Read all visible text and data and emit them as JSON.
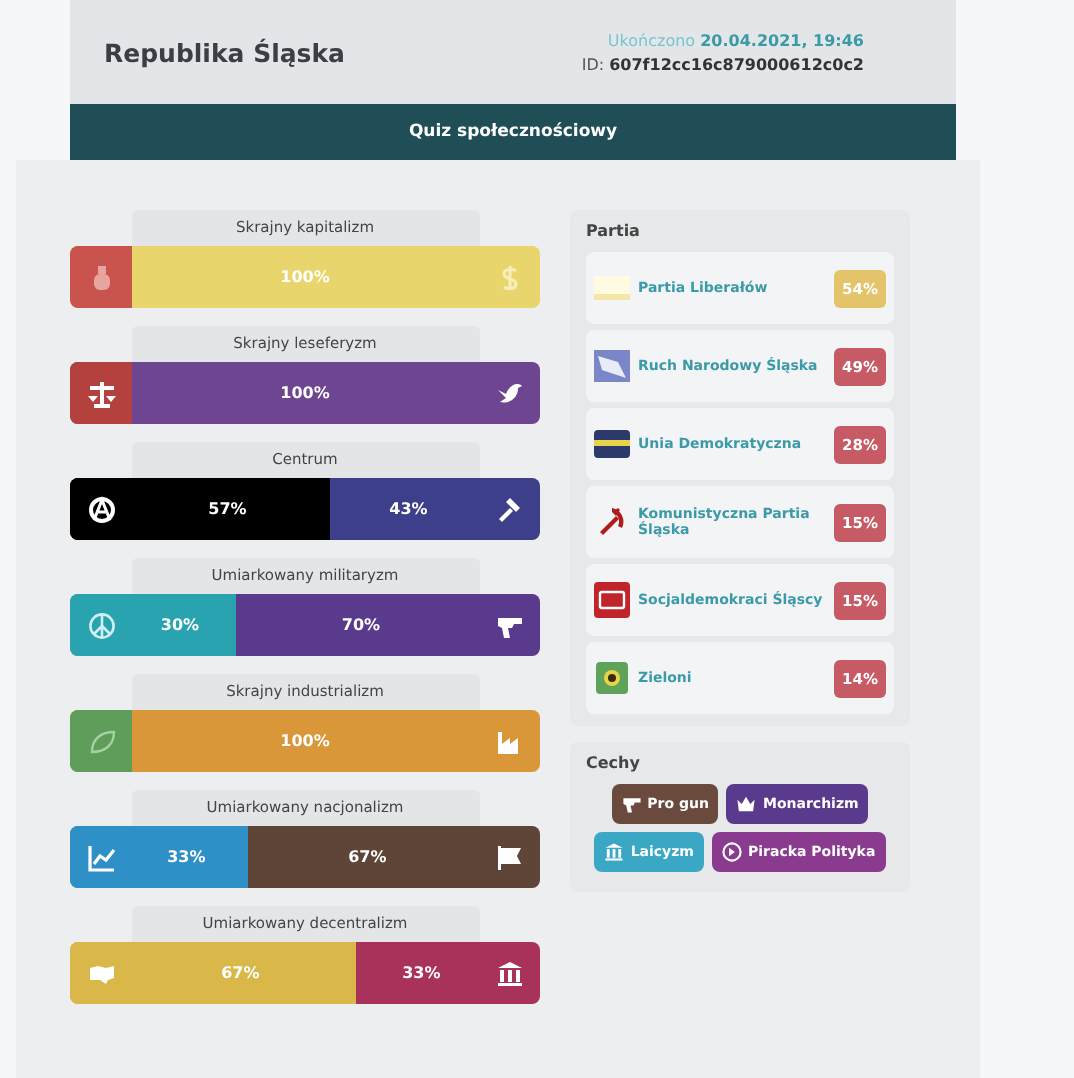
{
  "header": {
    "title": "Republika Śląska",
    "completed": "Ukończono **20.04.2021, 19:46**",
    "id": "ID: **607f12cc16c879000612c0c2**"
  },
  "banner": "Quiz społecznościowy",
  "axes": [
    {
      "label": "Skrajny kapitalizm",
      "segments": [
        {
          "text": "100%",
          "color": "#e8d66c"
        }
      ]
    },
    {
      "label": "Skrajny leseferyzm",
      "segments": [
        {
          "text": "100%",
          "color": "#6d4590"
        }
      ]
    },
    {
      "label": "Centrum",
      "segments": [
        {
          "text": "57%",
          "color": "#000000"
        },
        {
          "text": "43%",
          "color": "#3d3f8a"
        }
      ]
    },
    {
      "label": "Umiarkowany militaryzm",
      "segments": [
        {
          "text": "30%",
          "color": "#2aa3b0"
        },
        {
          "text": "70%",
          "color": "#5a3a8c"
        }
      ]
    },
    {
      "label": "Skrajny industrializm",
      "segments": [
        {
          "text": "100%",
          "color": "#d9973a"
        }
      ]
    },
    {
      "label": "Umiarkowany nacjonalizm",
      "segments": [
        {
          "text": "33%",
          "color": "#2f8fc7"
        },
        {
          "text": "67%",
          "color": "#5e4538"
        }
      ]
    },
    {
      "label": "Umiarkowany decentralizm",
      "segments": [
        {
          "text": "67%",
          "color": "#d9b748"
        },
        {
          "text": "33%",
          "color": "#a8325a"
        }
      ]
    }
  ],
  "parties": {
    "title": "Partia",
    "items": [
      {
        "name": "Partia Liberałów",
        "percent": "54%",
        "color": "#e3c46a"
      },
      {
        "name": "Ruch Narodowy Śląska",
        "percent": "49%",
        "color": "#c65b66"
      },
      {
        "name": "Unia Demokratyczna",
        "percent": "28%",
        "color": "#c65b66"
      },
      {
        "name": "Komunistyczna Partia Śląska",
        "percent": "15%",
        "color": "#c65b66"
      },
      {
        "name": "Socjaldemokraci Śląscy",
        "percent": "15%",
        "color": "#c65b66"
      },
      {
        "name": "Zieloni",
        "percent": "14%",
        "color": "#c65b66"
      }
    ]
  },
  "traits": {
    "title": "Cechy",
    "items": [
      {
        "label": "Pro gun",
        "color": "#6b4a3e"
      },
      {
        "label": "Monarchizm",
        "color": "#5a3a8c"
      },
      {
        "label": "Laicyzm",
        "color": "#3aa7c4"
      },
      {
        "label": "Piracka Polityka",
        "color": "#8a3b8f"
      }
    ]
  }
}
